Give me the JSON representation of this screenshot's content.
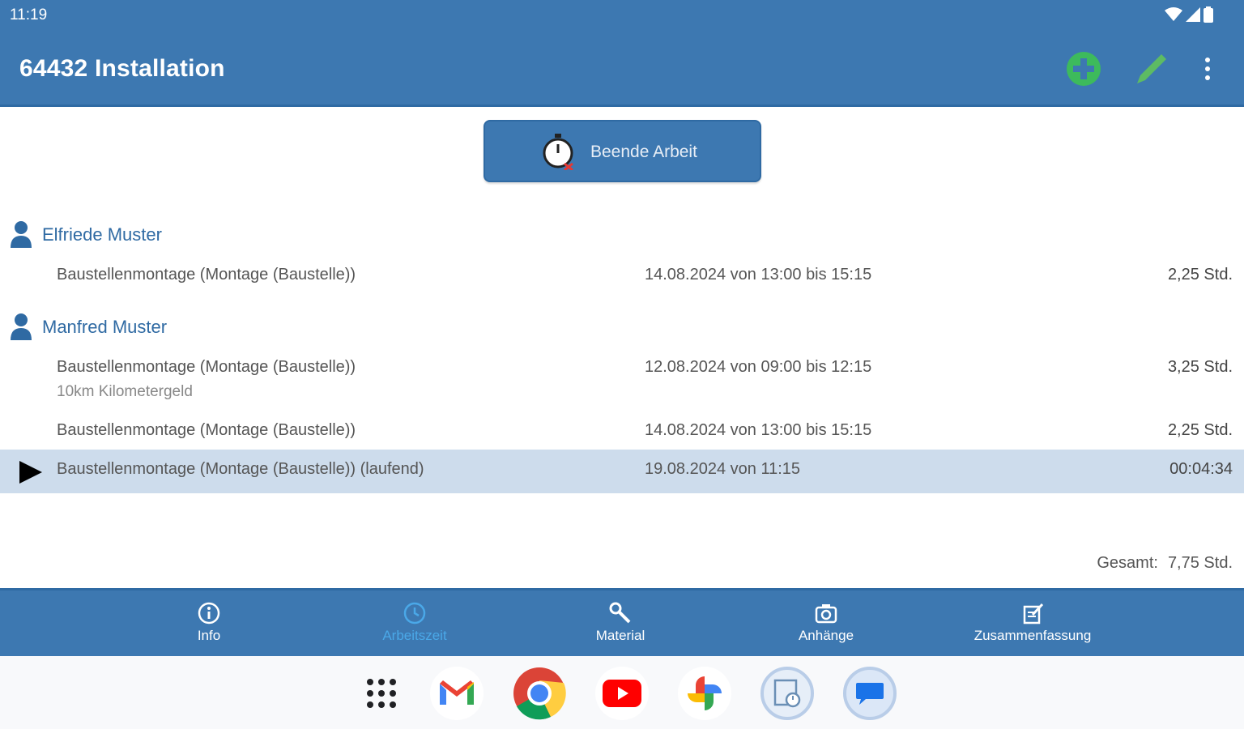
{
  "status_bar": {
    "time": "11:19"
  },
  "app_bar": {
    "title": "64432 Installation",
    "add_icon": "plus-circle-icon",
    "edit_icon": "pencil-icon",
    "menu_icon": "more-vert-icon",
    "add_color": "#3dba5c",
    "edit_color": "#5dbb63"
  },
  "end_work_button": {
    "label": "Beende Arbeit",
    "icon": "stopwatch-cancel-icon"
  },
  "persons": [
    {
      "name": "Elfriede Muster",
      "entries": [
        {
          "description": "Baustellenmontage (Montage (Baustelle))",
          "when": "14.08.2024 von 13:00 bis 15:15",
          "duration": "2,25 Std."
        }
      ]
    },
    {
      "name": "Manfred Muster",
      "entries": [
        {
          "description": "Baustellenmontage (Montage (Baustelle))",
          "note": "10km Kilometergeld",
          "when": "12.08.2024 von 09:00 bis 12:15",
          "duration": "3,25 Std."
        },
        {
          "description": "Baustellenmontage (Montage (Baustelle))",
          "when": "14.08.2024 von 13:00 bis 15:15",
          "duration": "2,25 Std."
        },
        {
          "description": "Baustellenmontage (Montage (Baustelle)) (laufend)",
          "when": "19.08.2024 von 11:15",
          "duration": "00:04:34",
          "running": true
        }
      ]
    }
  ],
  "total": {
    "label": "Gesamt:",
    "value": "7,75 Std."
  },
  "bottom_nav": [
    {
      "label": "Info",
      "icon": "info-icon",
      "active": false
    },
    {
      "label": "Arbeitszeit",
      "icon": "clock-icon",
      "active": true
    },
    {
      "label": "Material",
      "icon": "wrench-icon",
      "active": false
    },
    {
      "label": "Anhänge",
      "icon": "camera-icon",
      "active": false
    },
    {
      "label": "Zusammenfassung",
      "icon": "summary-icon",
      "active": false
    }
  ],
  "dock": [
    "app-drawer-icon",
    "gmail-icon",
    "chrome-icon",
    "youtube-icon",
    "photos-icon",
    "timesheet-app-icon",
    "messages-icon"
  ],
  "colors": {
    "primary": "#3d78b1",
    "highlight": "#cddcec",
    "active_tab": "#4aa8e8"
  }
}
